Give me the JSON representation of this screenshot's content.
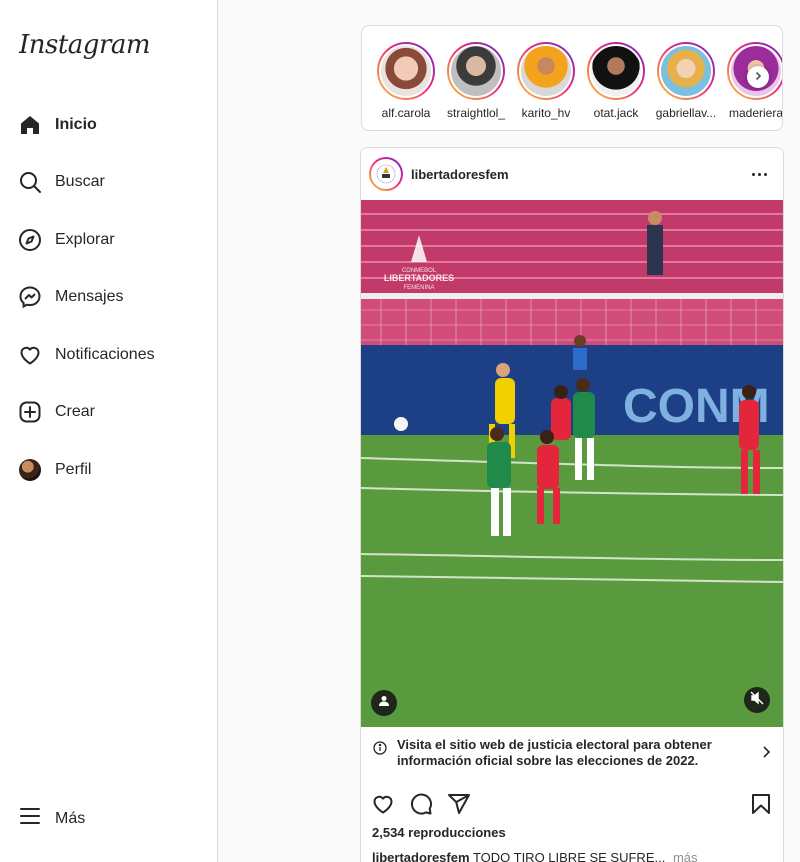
{
  "app": {
    "logo": "Instagram"
  },
  "sidebar": {
    "items": [
      {
        "label": "Inicio",
        "icon": "home-icon",
        "active": true
      },
      {
        "label": "Buscar",
        "icon": "search-icon"
      },
      {
        "label": "Explorar",
        "icon": "compass-icon"
      },
      {
        "label": "Mensajes",
        "icon": "messenger-icon"
      },
      {
        "label": "Notificaciones",
        "icon": "heart-icon"
      },
      {
        "label": "Crear",
        "icon": "plus-square-icon"
      },
      {
        "label": "Perfil",
        "icon": "avatar"
      }
    ],
    "more_label": "Más"
  },
  "stories": [
    {
      "name": "alf.carola"
    },
    {
      "name": "straightlol_"
    },
    {
      "name": "karito_hv"
    },
    {
      "name": "otat.jack"
    },
    {
      "name": "gabriellav..."
    },
    {
      "name": "maderiera"
    }
  ],
  "post": {
    "username": "libertadoresfem",
    "media_logo_text": [
      "CONMEBOL",
      "LIBERTADORES",
      "FEMENINA"
    ],
    "banner_text": "CONM",
    "notice": "Visita el sitio web de justicia electoral para obtener información oficial sobre las elecciones de 2022.",
    "views": "2,534 reproducciones",
    "caption_user": "libertadoresfem",
    "caption_text": "TODO TIRO LIBRE SE SUFRE...",
    "more_label": "más"
  },
  "colors": {
    "accent": "#0095f6",
    "text": "#262626",
    "border": "#dbdbdb",
    "muted": "#8e8e8e"
  }
}
